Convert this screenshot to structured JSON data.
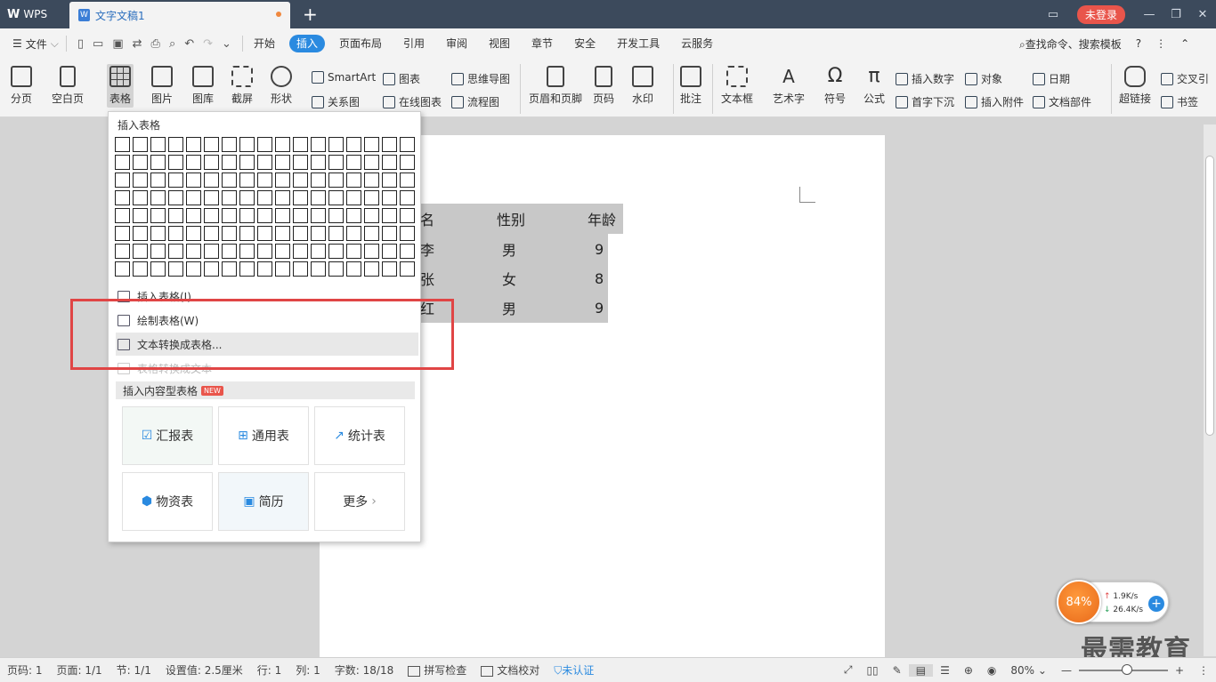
{
  "titlebar": {
    "app_name": "WPS",
    "doc_tab": "文字文稿1",
    "new_tab": "+",
    "login": "未登录"
  },
  "menubar": {
    "file": "文件",
    "tabs": [
      "开始",
      "插入",
      "页面布局",
      "引用",
      "审阅",
      "视图",
      "章节",
      "安全",
      "开发工具",
      "云服务"
    ],
    "active_tab": "插入",
    "search": "查找命令、搜索模板",
    "help": "?"
  },
  "ribbon": {
    "fenye": "分页",
    "kongbaiye": "空白页",
    "biaoge": "表格",
    "tupian": "图片",
    "tuku": "图库",
    "jieping": "截屏",
    "xingzhuang": "形状",
    "smartart": "SmartArt",
    "guanxitu": "关系图",
    "tubiao": "图表",
    "zaixiantubiao": "在线图表",
    "siweidaotu": "思维导图",
    "liuchengtu": "流程图",
    "yemeiyejiao": "页眉和页脚",
    "yema": "页码",
    "shuiyin": "水印",
    "pizhu": "批注",
    "wenbenkuang": "文本框",
    "yishuzi": "艺术字",
    "fuhao": "符号",
    "gongshi": "公式",
    "charushuzi": "插入数字",
    "duixiang": "对象",
    "riqi": "日期",
    "shouzixiachen": "首字下沉",
    "charufujian": "插入附件",
    "wendangbujian": "文档部件",
    "chaolianjie": "超链接",
    "jiaochayinyong": "交叉引",
    "shuqian": "书签"
  },
  "document": {
    "table": [
      [
        "名",
        "性别",
        "年龄"
      ],
      [
        "李",
        "男",
        "9"
      ],
      [
        "张",
        "女",
        "8"
      ],
      [
        "红",
        "男",
        "9"
      ]
    ]
  },
  "dropdown": {
    "title": "插入表格",
    "items": [
      {
        "label": "插入表格(I)",
        "enabled": true
      },
      {
        "label": "绘制表格(W)",
        "enabled": true
      },
      {
        "label": "文本转换成表格...",
        "enabled": true
      },
      {
        "label": "表格转换成文本",
        "enabled": false
      }
    ],
    "template_header": "插入内容型表格",
    "new_badge": "NEW",
    "templates": [
      "汇报表",
      "通用表",
      "统计表",
      "物资表",
      "简历",
      "更多"
    ]
  },
  "widget": {
    "percent": "84%",
    "upload": "1.9K/s",
    "download": "26.4K/s"
  },
  "watermark": "最需教育",
  "status": {
    "page": "页码: 1",
    "pages": "页面: 1/1",
    "section": "节: 1/1",
    "setting": "设置值: 2.5厘米",
    "row": "行: 1",
    "col": "列: 1",
    "words": "字数: 18/18",
    "spell": "拼写检查",
    "proof": "文档校对",
    "cert": "未认证",
    "zoom": "80%"
  },
  "colors": {
    "accent": "#2a8ae0",
    "titlebar": "#3c4a5c",
    "login": "#e9554b",
    "highlight_box": "#e04545"
  }
}
